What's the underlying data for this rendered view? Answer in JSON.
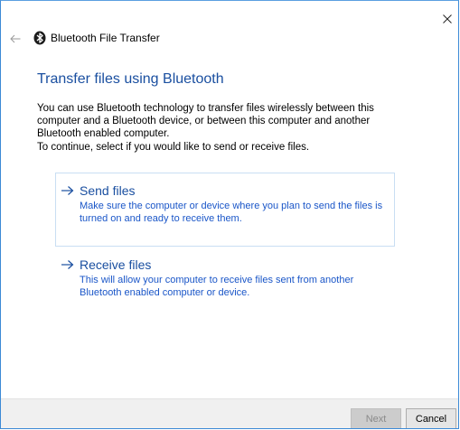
{
  "window": {
    "title": "Bluetooth File Transfer"
  },
  "icons": {
    "close": "close-icon",
    "back": "back-arrow-icon",
    "bluetooth": "bluetooth-icon",
    "option_arrow": "right-arrow-icon"
  },
  "content": {
    "heading": "Transfer files using Bluetooth",
    "intro": "You can use Bluetooth technology to transfer files wirelessly between this computer and a Bluetooth device, or between this computer and another Bluetooth enabled computer.",
    "instruction": "To continue, select if you would like to send or receive files."
  },
  "options": [
    {
      "title": "Send files",
      "description": "Make sure the computer or device where you plan to send the files is turned on and ready to receive them."
    },
    {
      "title": "Receive files",
      "description": "This will allow your computer to receive files sent from another Bluetooth enabled computer or device."
    }
  ],
  "footer": {
    "next_label": "Next",
    "cancel_label": "Cancel",
    "next_enabled": false
  },
  "colors": {
    "accent_heading": "#1a4fa0",
    "link_text": "#1a56c8",
    "window_border": "#3c8ad6",
    "footer_bg": "#f0f0f0"
  }
}
